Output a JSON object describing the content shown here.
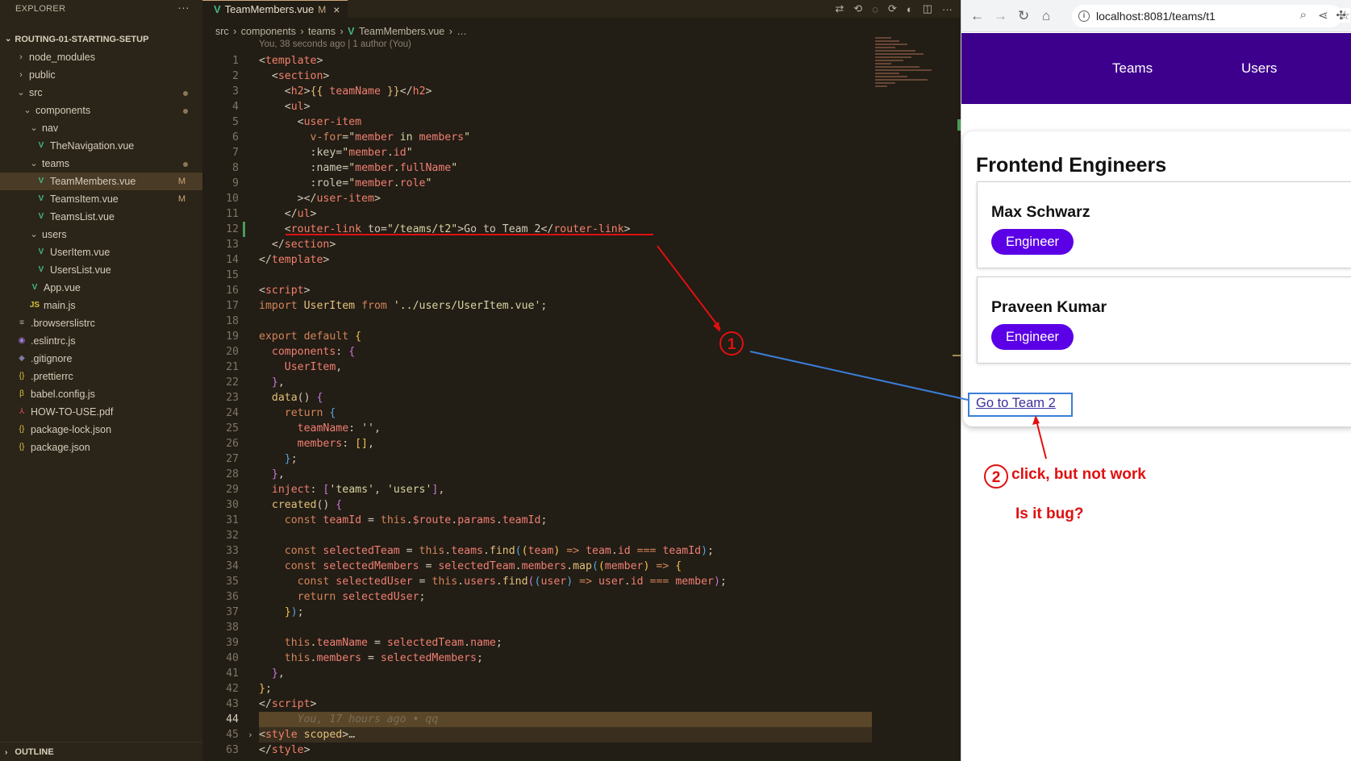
{
  "explorer": {
    "title": "EXPLORER",
    "more": "···",
    "project": "ROUTING-01-STARTING-SETUP",
    "items": [
      {
        "label": "node_modules",
        "kind": "folder",
        "open": false,
        "indent": 0
      },
      {
        "label": "public",
        "kind": "folder",
        "open": false,
        "indent": 0
      },
      {
        "label": "src",
        "kind": "folder",
        "open": true,
        "indent": 0,
        "dot": true
      },
      {
        "label": "components",
        "kind": "folder",
        "open": true,
        "indent": 1,
        "dot": true
      },
      {
        "label": "nav",
        "kind": "folder",
        "open": true,
        "indent": 2
      },
      {
        "label": "TheNavigation.vue",
        "kind": "vue",
        "indent": 3
      },
      {
        "label": "teams",
        "kind": "folder",
        "open": true,
        "indent": 2,
        "dot": true
      },
      {
        "label": "TeamMembers.vue",
        "kind": "vue",
        "indent": 3,
        "badge": "M",
        "selected": true
      },
      {
        "label": "TeamsItem.vue",
        "kind": "vue",
        "indent": 3,
        "badge": "M"
      },
      {
        "label": "TeamsList.vue",
        "kind": "vue",
        "indent": 3
      },
      {
        "label": "users",
        "kind": "folder",
        "open": true,
        "indent": 2
      },
      {
        "label": "UserItem.vue",
        "kind": "vue",
        "indent": 3
      },
      {
        "label": "UsersList.vue",
        "kind": "vue",
        "indent": 3
      },
      {
        "label": "App.vue",
        "kind": "vue",
        "indent": 2
      },
      {
        "label": "main.js",
        "kind": "js",
        "indent": 2
      },
      {
        "label": ".browserslistrc",
        "kind": "list",
        "indent": 0
      },
      {
        "label": ".eslintrc.js",
        "kind": "eslint",
        "indent": 0
      },
      {
        "label": ".gitignore",
        "kind": "git",
        "indent": 0
      },
      {
        "label": ".prettierrc",
        "kind": "json",
        "indent": 0
      },
      {
        "label": "babel.config.js",
        "kind": "babel",
        "indent": 0
      },
      {
        "label": "HOW-TO-USE.pdf",
        "kind": "pdf",
        "indent": 0
      },
      {
        "label": "package-lock.json",
        "kind": "json",
        "indent": 0
      },
      {
        "label": "package.json",
        "kind": "json",
        "indent": 0
      }
    ],
    "outline": "OUTLINE"
  },
  "editor": {
    "tab_label": "TeamMembers.vue",
    "tab_badge": "M",
    "tab_close": "×",
    "breadcrumb": [
      "src",
      "components",
      "teams",
      "TeamMembers.vue",
      "…"
    ],
    "blame": "You, 38 seconds ago | 1 author (You)",
    "current_line": 44,
    "lines": [
      {
        "n": 1,
        "html": "<span class='t-br'>&lt;</span><span class='t-tag'>template</span><span class='t-br'>&gt;</span>"
      },
      {
        "n": 2,
        "html": "  <span class='t-br'>&lt;</span><span class='t-tag'>section</span><span class='t-br'>&gt;</span>"
      },
      {
        "n": 3,
        "html": "    <span class='t-br'>&lt;</span><span class='t-tag'>h2</span><span class='t-br'>&gt;</span><span class='t-fn'>{{ </span><span class='t-var'>teamName</span><span class='t-fn'> }}</span><span class='t-br'>&lt;/</span><span class='t-tag'>h2</span><span class='t-br'>&gt;</span>"
      },
      {
        "n": 4,
        "html": "    <span class='t-br'>&lt;</span><span class='t-tag'>ul</span><span class='t-br'>&gt;</span>"
      },
      {
        "n": 5,
        "html": "      <span class='t-br'>&lt;</span><span class='t-tag'>user-item</span>"
      },
      {
        "n": 6,
        "html": "        <span class='t-kw'>v-for</span>=<span class='t-str'>\"</span><span class='t-var'>member</span><span class='t-str'> in </span><span class='t-var'>members</span><span class='t-str'>\"</span>"
      },
      {
        "n": 7,
        "html": "        <span class='t-attr'>:key</span>=<span class='t-str'>\"</span><span class='t-var'>member</span><span class='t-str'>.</span><span class='t-var'>id</span><span class='t-str'>\"</span>"
      },
      {
        "n": 8,
        "html": "        <span class='t-attr'>:name</span>=<span class='t-str'>\"</span><span class='t-var'>member</span><span class='t-str'>.</span><span class='t-var'>fullName</span><span class='t-str'>\"</span>"
      },
      {
        "n": 9,
        "html": "        <span class='t-attr'>:role</span>=<span class='t-str'>\"</span><span class='t-var'>member</span><span class='t-str'>.</span><span class='t-var'>role</span><span class='t-str'>\"</span>"
      },
      {
        "n": 10,
        "html": "      <span class='t-br'>&gt;&lt;/</span><span class='t-tag'>user-item</span><span class='t-br'>&gt;</span>"
      },
      {
        "n": 11,
        "html": "    <span class='t-br'>&lt;/</span><span class='t-tag'>ul</span><span class='t-br'>&gt;</span>"
      },
      {
        "n": 12,
        "git": true,
        "html": "    <span class='t-br'>&lt;</span><span class='t-tag'>router-link</span> <span class='t-attr'>to</span>=<span class='t-str'>\"/teams/t2\"</span><span class='t-br'>&gt;</span>Go to Team 2<span class='t-br'>&lt;/</span><span class='t-tag'>router-link</span><span class='t-br'>&gt;</span>"
      },
      {
        "n": 13,
        "html": "  <span class='t-br'>&lt;/</span><span class='t-tag'>section</span><span class='t-br'>&gt;</span>"
      },
      {
        "n": 14,
        "html": "<span class='t-br'>&lt;/</span><span class='t-tag'>template</span><span class='t-br'>&gt;</span>"
      },
      {
        "n": 15,
        "html": ""
      },
      {
        "n": 16,
        "html": "<span class='t-br'>&lt;</span><span class='t-tag'>script</span><span class='t-br'>&gt;</span>"
      },
      {
        "n": 17,
        "html": "<span class='t-kw'>import</span> <span class='t-fn'>UserItem</span> <span class='t-kw'>from</span> <span class='t-str'>'../users/UserItem.vue'</span>;"
      },
      {
        "n": 18,
        "html": ""
      },
      {
        "n": 19,
        "html": "<span class='t-kw'>export default</span> <span class='t-y'>{</span>"
      },
      {
        "n": 20,
        "html": "  <span class='t-var'>components</span>: <span class='t-p'>{</span>"
      },
      {
        "n": 21,
        "html": "    <span class='t-var'>UserItem</span>,"
      },
      {
        "n": 22,
        "html": "  <span class='t-p'>}</span>,"
      },
      {
        "n": 23,
        "html": "  <span class='t-fn'>data</span>() <span class='t-p'>{</span>"
      },
      {
        "n": 24,
        "html": "    <span class='t-kw'>return</span> <span class='t-b'>{</span>"
      },
      {
        "n": 25,
        "html": "      <span class='t-var'>teamName</span>: <span class='t-str'>''</span>,"
      },
      {
        "n": 26,
        "html": "      <span class='t-var'>members</span>: <span class='t-y'>[]</span>,"
      },
      {
        "n": 27,
        "html": "    <span class='t-b'>}</span>;"
      },
      {
        "n": 28,
        "html": "  <span class='t-p'>}</span>,"
      },
      {
        "n": 29,
        "html": "  <span class='t-var'>inject</span>: <span class='t-p'>[</span><span class='t-str'>'teams'</span>, <span class='t-str'>'users'</span><span class='t-p'>]</span>,"
      },
      {
        "n": 30,
        "html": "  <span class='t-fn'>created</span>() <span class='t-p'>{</span>"
      },
      {
        "n": 31,
        "html": "    <span class='t-kw'>const</span> <span class='t-var'>teamId</span> = <span class='t-kw'>this</span>.<span class='t-var'>$route</span>.<span class='t-var'>params</span>.<span class='t-var'>teamId</span>;"
      },
      {
        "n": 32,
        "html": ""
      },
      {
        "n": 33,
        "html": "    <span class='t-kw'>const</span> <span class='t-var'>selectedTeam</span> = <span class='t-kw'>this</span>.<span class='t-var'>teams</span>.<span class='t-fn'>find</span><span class='t-b'>(</span><span class='t-y'>(</span><span class='t-var'>team</span><span class='t-y'>)</span> <span class='t-kw'>=&gt;</span> <span class='t-var'>team</span>.<span class='t-var'>id</span> <span class='t-kw'>===</span> <span class='t-var'>teamId</span><span class='t-b'>)</span>;"
      },
      {
        "n": 34,
        "html": "    <span class='t-kw'>const</span> <span class='t-var'>selectedMembers</span> = <span class='t-var'>selectedTeam</span>.<span class='t-var'>members</span>.<span class='t-fn'>map</span><span class='t-b'>(</span><span class='t-y'>(</span><span class='t-var'>member</span><span class='t-y'>)</span> <span class='t-kw'>=&gt;</span> <span class='t-y'>{</span>"
      },
      {
        "n": 35,
        "html": "      <span class='t-kw'>const</span> <span class='t-var'>selectedUser</span> = <span class='t-kw'>this</span>.<span class='t-var'>users</span>.<span class='t-fn'>find</span><span class='t-p'>(</span><span class='t-b'>(</span><span class='t-var'>user</span><span class='t-b'>)</span> <span class='t-kw'>=&gt;</span> <span class='t-var'>user</span>.<span class='t-var'>id</span> <span class='t-kw'>===</span> <span class='t-var'>member</span><span class='t-p'>)</span>;"
      },
      {
        "n": 36,
        "html": "      <span class='t-kw'>return</span> <span class='t-var'>selectedUser</span>;"
      },
      {
        "n": 37,
        "html": "    <span class='t-y'>}</span><span class='t-b'>)</span>;"
      },
      {
        "n": 38,
        "html": ""
      },
      {
        "n": 39,
        "html": "    <span class='t-kw'>this</span>.<span class='t-var'>teamName</span> = <span class='t-var'>selectedTeam</span>.<span class='t-var'>name</span>;"
      },
      {
        "n": 40,
        "html": "    <span class='t-kw'>this</span>.<span class='t-var'>members</span> = <span class='t-var'>selectedMembers</span>;"
      },
      {
        "n": 41,
        "html": "  <span class='t-p'>}</span>,"
      },
      {
        "n": 42,
        "html": "<span class='t-y'>}</span>;"
      },
      {
        "n": 43,
        "html": "<span class='t-br'>&lt;/</span><span class='t-tag'>script</span><span class='t-br'>&gt;</span>"
      },
      {
        "n": 44,
        "hl": true,
        "html": "      <span class='t-ghost'>You, 17 hours ago • qq</span>"
      },
      {
        "n": 45,
        "hl2": true,
        "fold": true,
        "html": "<span class='t-br'>&lt;</span><span class='t-tag'>style</span> <span class='t-fn'>scoped</span><span class='t-br'>&gt;</span>…"
      },
      {
        "n": 63,
        "html": "<span class='t-br'>&lt;/</span><span class='t-tag'>style</span><span class='t-br'>&gt;</span>"
      }
    ]
  },
  "browser": {
    "url": "localhost:8081/teams/t1",
    "nav": {
      "teams": "Teams",
      "users": "Users"
    },
    "header_color": "#3d008d",
    "team_name": "Frontend Engineers",
    "members": [
      {
        "name": "Max Schwarz",
        "role": "Engineer"
      },
      {
        "name": "Praveen Kumar",
        "role": "Engineer"
      }
    ],
    "router_link_text": "Go to Team 2"
  },
  "annotations": {
    "marker1": "1",
    "marker2": "2",
    "note_line1": "click, but not work",
    "note_line2": "Is it bug?",
    "annotation_color": "#e01010"
  }
}
